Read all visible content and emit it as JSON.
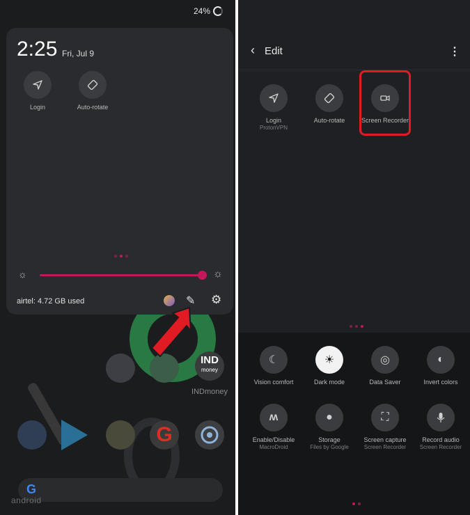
{
  "left": {
    "status": {
      "battery": "24%"
    },
    "qs": {
      "time": "2:25",
      "date": "Fri, Jul 9",
      "tiles": [
        {
          "label": "Login",
          "icon": "navigation-arrow-icon"
        },
        {
          "label": "Auto-rotate",
          "icon": "auto-rotate-icon"
        }
      ],
      "data_usage": "airtel: 4.72 GB used",
      "brightness": 0.98
    },
    "home": {
      "ind_icon": "IND",
      "ind_icon_sub": "money",
      "ind_label": "INDmoney",
      "google_letter": "G",
      "watermark": "android"
    }
  },
  "right": {
    "header": {
      "title": "Edit"
    },
    "active_tiles": [
      {
        "label": "Login",
        "sublabel": "ProtonVPN",
        "icon": "navigation-arrow-icon"
      },
      {
        "label": "Auto-rotate",
        "sublabel": "",
        "icon": "auto-rotate-icon"
      },
      {
        "label": "Screen Recorder",
        "sublabel": "",
        "icon": "video-camera-icon"
      }
    ],
    "available_tiles": [
      {
        "label": "Vision comfort",
        "sublabel": "",
        "icon": "moon-icon"
      },
      {
        "label": "Dark mode",
        "sublabel": "",
        "icon": "dark-mode-icon"
      },
      {
        "label": "Data Saver",
        "sublabel": "",
        "icon": "data-saver-icon"
      },
      {
        "label": "Invert colors",
        "sublabel": "",
        "icon": "invert-colors-icon"
      },
      {
        "label": "Enable/Disable",
        "sublabel": "MacroDroid",
        "icon": "macrodroid-icon"
      },
      {
        "label": "Storage",
        "sublabel": "Files by Google",
        "icon": "storage-icon"
      },
      {
        "label": "Screen capture",
        "sublabel": "Screen Recorder",
        "icon": "screen-capture-icon"
      },
      {
        "label": "Record audio",
        "sublabel": "Screen Recorder",
        "icon": "microphone-icon"
      }
    ]
  },
  "colors": {
    "accent": "#c2185b",
    "highlight": "#e01b24"
  }
}
